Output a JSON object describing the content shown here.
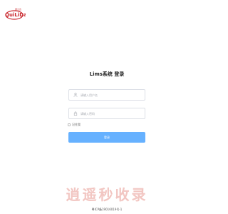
{
  "logo": {
    "text": "QuiLiDa",
    "subtext": "康立达"
  },
  "title": "Lims系统 登录",
  "username": {
    "placeholder": "请输入用户名",
    "icon": "user-icon"
  },
  "password": {
    "placeholder": "请输入密码",
    "icon": "lock-icon"
  },
  "remember_label": "记住我",
  "login_label": "登录",
  "watermark": "逍遥秒收录",
  "footer": "粤ICP备19016019号-1",
  "colors": {
    "accent": "#66b1ff",
    "logo_red": "#c9272d",
    "watermark": "#f2c6c2"
  }
}
